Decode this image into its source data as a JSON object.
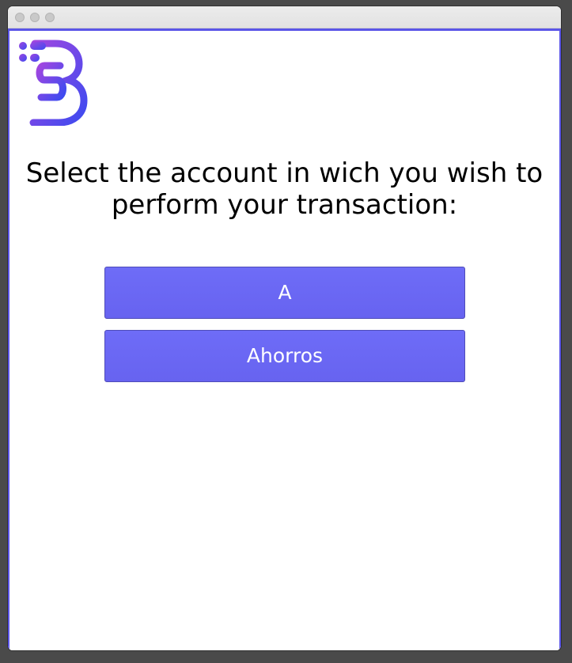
{
  "window": {
    "controls": [
      "close",
      "minimize",
      "maximize"
    ]
  },
  "logo": {
    "icon": "bank-b-logo-icon",
    "gradient_start": "#a046e0",
    "gradient_end": "#3d4bf0"
  },
  "main": {
    "prompt": "Select the account in wich you wish to perform your transaction:",
    "accounts": [
      {
        "label": "A"
      },
      {
        "label": "Ahorros"
      }
    ]
  },
  "colors": {
    "accent": "#5b55e8",
    "button": "#6c6af5",
    "button_text": "#ffffff"
  }
}
